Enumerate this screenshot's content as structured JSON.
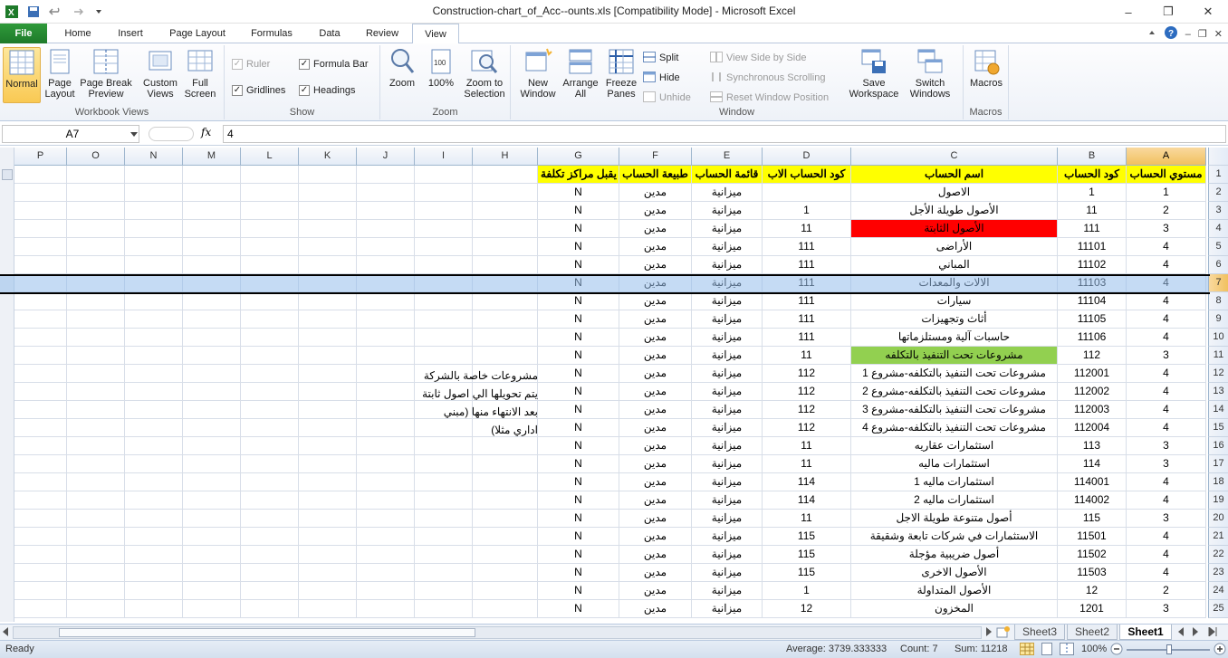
{
  "window": {
    "title": "Construction-chart_of_Acc--ounts.xls  [Compatibility Mode]  -  Microsoft Excel",
    "minimize_icon": "minimize-icon",
    "restore_icon": "restore-icon",
    "close_icon": "close-icon"
  },
  "qat": {
    "save_icon": "save-icon",
    "undo_icon": "undo-icon",
    "redo_icon": "redo-icon",
    "customize_icon": "chevron-down-icon"
  },
  "tabs": [
    {
      "label": "File"
    },
    {
      "label": "Home"
    },
    {
      "label": "Insert"
    },
    {
      "label": "Page Layout"
    },
    {
      "label": "Formulas"
    },
    {
      "label": "Data"
    },
    {
      "label": "Review"
    },
    {
      "label": "View"
    }
  ],
  "ribbon": {
    "workbook_views": {
      "label": "Workbook Views",
      "normal": "Normal",
      "page_layout": [
        "Page",
        "Layout"
      ],
      "page_break": [
        "Page Break",
        "Preview"
      ],
      "custom_views": [
        "Custom",
        "Views"
      ],
      "full_screen": [
        "Full",
        "Screen"
      ]
    },
    "show": {
      "label": "Show",
      "ruler": "Ruler",
      "formula_bar": "Formula Bar",
      "gridlines": "Gridlines",
      "headings": "Headings"
    },
    "zoom": {
      "label": "Zoom",
      "zoom": "Zoom",
      "hundred": "100%",
      "zoom_to_selection": [
        "Zoom to",
        "Selection"
      ]
    },
    "window": {
      "label": "Window",
      "new_window": [
        "New",
        "Window"
      ],
      "arrange_all": [
        "Arrange",
        "All"
      ],
      "freeze_panes": [
        "Freeze",
        "Panes"
      ],
      "split": "Split",
      "hide": "Hide",
      "unhide": "Unhide",
      "view_side": "View Side by Side",
      "sync_scroll": "Synchronous Scrolling",
      "reset_pos": "Reset Window Position",
      "save_workspace": [
        "Save",
        "Workspace"
      ],
      "switch_windows": [
        "Switch",
        "Windows"
      ]
    },
    "macros": {
      "label": "Macros",
      "macros": "Macros"
    }
  },
  "formula_bar": {
    "name_box": "A7",
    "fx": "fx",
    "value": "4"
  },
  "columns": [
    "P",
    "O",
    "N",
    "M",
    "L",
    "K",
    "J",
    "I",
    "H",
    "G",
    "F",
    "E",
    "D",
    "C",
    "B",
    "A"
  ],
  "headers": {
    "G": "يقبل مراكز تكلفة",
    "F": "طبيعة الحساب",
    "E": "قائمة الحساب",
    "D": "كود الحساب الاب",
    "C": "اسم الحساب",
    "B": "كود الحساب",
    "A": "مستوي الحساب"
  },
  "rows": [
    {
      "n": "2",
      "A": "1",
      "B": "1",
      "C": "الاصول",
      "D": "",
      "E": "ميزانية",
      "F": "مدين",
      "G": "N"
    },
    {
      "n": "3",
      "A": "2",
      "B": "11",
      "C": "الأصول طويلة الأجل",
      "D": "1",
      "E": "ميزانية",
      "F": "مدين",
      "G": "N"
    },
    {
      "n": "4",
      "A": "3",
      "B": "111",
      "C": "الأصول الثابتة",
      "D": "11",
      "E": "ميزانية",
      "F": "مدين",
      "G": "N"
    },
    {
      "n": "5",
      "A": "4",
      "B": "11101",
      "C": "الأراضى",
      "D": "111",
      "E": "ميزانية",
      "F": "مدين",
      "G": "N"
    },
    {
      "n": "6",
      "A": "4",
      "B": "11102",
      "C": "المباني",
      "D": "111",
      "E": "ميزانية",
      "F": "مدين",
      "G": "N"
    },
    {
      "n": "7",
      "A": "4",
      "B": "11103",
      "C": "الالات والمعدات",
      "D": "111",
      "E": "ميزانية",
      "F": "مدين",
      "G": "N"
    },
    {
      "n": "8",
      "A": "4",
      "B": "11104",
      "C": "سيارات",
      "D": "111",
      "E": "ميزانية",
      "F": "مدين",
      "G": "N"
    },
    {
      "n": "9",
      "A": "4",
      "B": "11105",
      "C": "أثاث وتجهيزات",
      "D": "111",
      "E": "ميزانية",
      "F": "مدين",
      "G": "N"
    },
    {
      "n": "10",
      "A": "4",
      "B": "11106",
      "C": "حاسبات آلية ومستلزماتها",
      "D": "111",
      "E": "ميزانية",
      "F": "مدين",
      "G": "N"
    },
    {
      "n": "11",
      "A": "3",
      "B": "112",
      "C": "مشروعات تحت التنفيذ بالتكلفه",
      "D": "11",
      "E": "ميزانية",
      "F": "مدين",
      "G": "N"
    },
    {
      "n": "12",
      "A": "4",
      "B": "112001",
      "C": "مشروعات تحت التنفيذ بالتكلفه-مشروع 1",
      "D": "112",
      "E": "ميزانية",
      "F": "مدين",
      "G": "N"
    },
    {
      "n": "13",
      "A": "4",
      "B": "112002",
      "C": "مشروعات تحت التنفيذ بالتكلفه-مشروع 2",
      "D": "112",
      "E": "ميزانية",
      "F": "مدين",
      "G": "N"
    },
    {
      "n": "14",
      "A": "4",
      "B": "112003",
      "C": "مشروعات تحت التنفيذ بالتكلفه-مشروع 3",
      "D": "112",
      "E": "ميزانية",
      "F": "مدين",
      "G": "N"
    },
    {
      "n": "15",
      "A": "4",
      "B": "112004",
      "C": "مشروعات تحت التنفيذ بالتكلفه-مشروع 4",
      "D": "112",
      "E": "ميزانية",
      "F": "مدين",
      "G": "N"
    },
    {
      "n": "16",
      "A": "3",
      "B": "113",
      "C": "استثمارات عقاريه",
      "D": "11",
      "E": "ميزانية",
      "F": "مدين",
      "G": "N"
    },
    {
      "n": "17",
      "A": "3",
      "B": "114",
      "C": "استثمارات ماليه",
      "D": "11",
      "E": "ميزانية",
      "F": "مدين",
      "G": "N"
    },
    {
      "n": "18",
      "A": "4",
      "B": "114001",
      "C": "استثمارات ماليه 1",
      "D": "114",
      "E": "ميزانية",
      "F": "مدين",
      "G": "N"
    },
    {
      "n": "19",
      "A": "4",
      "B": "114002",
      "C": "استثمارات ماليه 2",
      "D": "114",
      "E": "ميزانية",
      "F": "مدين",
      "G": "N"
    },
    {
      "n": "20",
      "A": "3",
      "B": "115",
      "C": "أصول متنوعة طويلة الاجل",
      "D": "11",
      "E": "ميزانية",
      "F": "مدين",
      "G": "N"
    },
    {
      "n": "21",
      "A": "4",
      "B": "11501",
      "C": "الاستثمارات في شركات تابعة وشقيقة",
      "D": "115",
      "E": "ميزانية",
      "F": "مدين",
      "G": "N"
    },
    {
      "n": "22",
      "A": "4",
      "B": "11502",
      "C": "أصول ضريبية مؤجلة",
      "D": "115",
      "E": "ميزانية",
      "F": "مدين",
      "G": "N"
    },
    {
      "n": "23",
      "A": "4",
      "B": "11503",
      "C": "الأصول الاخرى",
      "D": "115",
      "E": "ميزانية",
      "F": "مدين",
      "G": "N"
    },
    {
      "n": "24",
      "A": "2",
      "B": "12",
      "C": "الأصول المتداولة",
      "D": "1",
      "E": "ميزانية",
      "F": "مدين",
      "G": "N"
    },
    {
      "n": "25",
      "A": "3",
      "B": "1201",
      "C": "المخزون",
      "D": "12",
      "E": "ميزانية",
      "F": "مدين",
      "G": "N"
    }
  ],
  "note_lines": [
    "مشروعات خاصة بالشركة",
    "يتم تحويلها الي اصول ثابتة",
    "بعد الانتهاء منها (مبني",
    "اداري مثلا)"
  ],
  "sheets": [
    "Sheet3",
    "Sheet2",
    "Sheet1"
  ],
  "status": {
    "ready": "Ready",
    "average": "Average: 3739.333333",
    "count": "Count: 7",
    "sum": "Sum: 11218",
    "zoom": "100%"
  },
  "colors": {
    "header_fill": "#ffff00",
    "red_fill": "#ff0000",
    "green_fill": "#92d050",
    "file_tab": "#2f9a3a"
  }
}
